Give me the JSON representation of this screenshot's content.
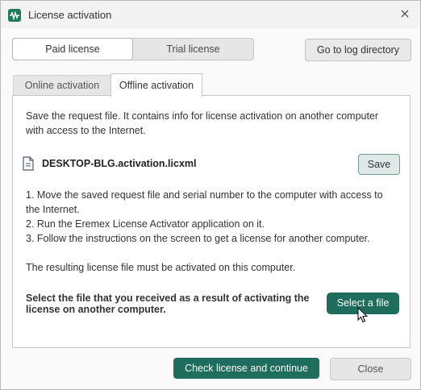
{
  "window": {
    "title": "License activation",
    "accent_color": "#1f6d5c"
  },
  "license_type": {
    "options": [
      "Paid license",
      "Trial license"
    ],
    "selected": "Paid license"
  },
  "toolbar": {
    "log_button_label": "Go to log directory"
  },
  "tabs": [
    {
      "label": "Online activation",
      "active": false
    },
    {
      "label": "Offline activation",
      "active": true
    }
  ],
  "offline": {
    "intro_line1": "Save the request file. It contains info for license activation on another computer",
    "intro_line2": "with access to the Internet.",
    "file_name": "DESKTOP-BLG.activation.licxml",
    "save_label": "Save",
    "step1_line1": "1. Move the saved request file and serial number to the computer with access to",
    "step1_line2": "the Internet.",
    "step2": "2. Run the Eremex License Activator application on it.",
    "step3": "3. Follow the instructions on the screen to get a license for another computer.",
    "note": "The resulting license file must be activated on this computer.",
    "select_prompt_line1": "Select the file that you received as a result of activating the",
    "select_prompt_line2": "license on another computer.",
    "select_file_label": "Select a file"
  },
  "footer": {
    "check_label": "Check license and continue",
    "close_label": "Close"
  },
  "icons": {
    "app": "eremex-app-icon",
    "close": "close-icon",
    "file": "document-icon",
    "cursor": "mouse-pointer-icon"
  }
}
